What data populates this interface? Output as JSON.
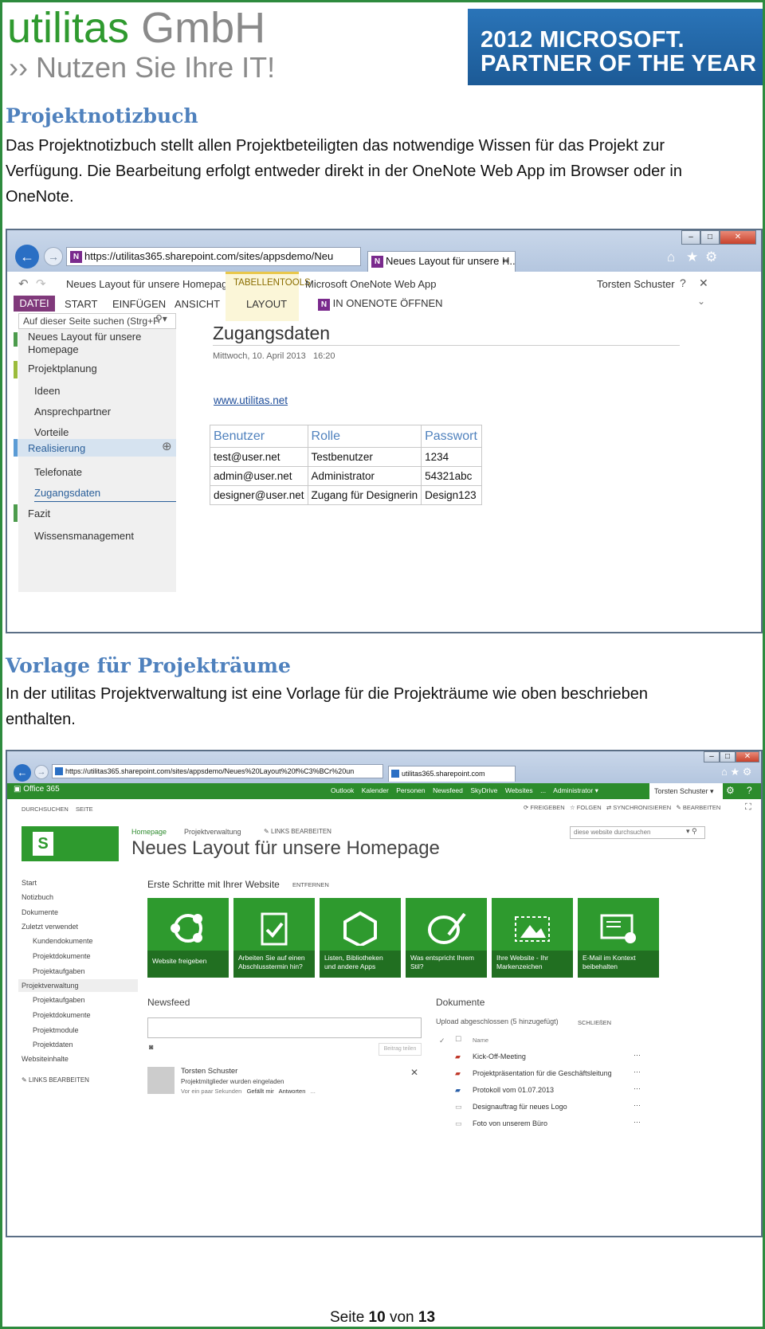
{
  "header": {
    "company_name": "utilitas",
    "company_suffix": "GmbH",
    "slogan": "›› Nutzen Sie Ihre IT!",
    "partner_line1": "2012 MICROSOFT.",
    "partner_line2": "PARTNER OF THE YEAR"
  },
  "sections": [
    {
      "heading": "Projektnotizbuch",
      "text_l1": "Das Projektnotizbuch stellt allen Projektbeteiligten das notwendige Wissen für das Projekt zur",
      "text_l2": "Verfügung. Die Bearbeitung erfolgt entweder direkt in der OneNote Web App im Browser oder in",
      "text_l3": "OneNote."
    },
    {
      "heading": "Vorlage für Projekträume",
      "text_l1": "In der utilitas Projektverwaltung ist eine Vorlage für die Projekträume wie oben beschrieben",
      "text_l2": "enthalten."
    }
  ],
  "onenote": {
    "url": "https://utilitas365.sharepoint.com/sites/appsdemo/Neu",
    "tab_title": "Neues Layout für unsere H...",
    "breadcrumb": "Neues Layout für unsere Homepage_I",
    "tabellentools": "TABELLENTOOLS",
    "app_name": "Microsoft OneNote Web App",
    "user": "Torsten Schuster",
    "ribbon": {
      "datei": "DATEI",
      "start": "START",
      "einfuegen": "EINFÜGEN",
      "ansicht": "ANSICHT",
      "layout": "LAYOUT",
      "open_in": "IN ONENOTE ÖFFNEN"
    },
    "search_placeholder": "Auf dieser Seite suchen (Strg+F",
    "nav": {
      "s1_l1": "Neues Layout für unsere",
      "s1_l2": "Homepage",
      "s2": "Projektplanung",
      "p_ideen": "Ideen",
      "p_ansprech": "Ansprechpartner",
      "p_vorteile": "Vorteile",
      "s3": "Realisierung",
      "p_telefonate": "Telefonate",
      "p_zugang": "Zugangsdaten",
      "s4": "Fazit",
      "p_wissen": "Wissensmanagement"
    },
    "page_title": "Zugangsdaten",
    "page_date": "Mittwoch, 10. April 2013",
    "page_time": "16:20",
    "link": "www.utilitas.net",
    "table": {
      "headers": [
        "Benutzer",
        "Rolle",
        "Passwort"
      ],
      "rows": [
        [
          "test@user.net",
          "Testbenutzer",
          "1234"
        ],
        [
          "admin@user.net",
          "Administrator",
          "54321abc"
        ],
        [
          "designer@user.net",
          "Zugang für Designerin",
          "Design123"
        ]
      ]
    }
  },
  "sharepoint": {
    "url": "https://utilitas365.sharepoint.com/sites/appsdemo/Neues%20Layout%20f%C3%BCr%20un",
    "tab_title": "utilitas365.sharepoint.com",
    "brand": "Office 365",
    "topnav": [
      "Outlook",
      "Kalender",
      "Personen",
      "Newsfeed",
      "SkyDrive",
      "Websites",
      "...",
      "Administrator ▾"
    ],
    "user": "Torsten Schuster ▾",
    "durchsuchen": "DURCHSUCHEN",
    "seite": "SEITE",
    "actions": {
      "freigeben": "FREIGEBEN",
      "folgen": "FOLGEN",
      "sync": "SYNCHRONISIEREN",
      "bearbeiten": "BEARBEITEN"
    },
    "crumb_home": "Homepage",
    "crumb_pv": "Projektverwaltung",
    "links_bearbeiten": "LINKS BEARBEITEN",
    "site_title": "Neues Layout für unsere Homepage",
    "search_placeholder": "diese website durchsuchen",
    "leftnav": [
      "Start",
      "Notizbuch",
      "Dokumente",
      "Zuletzt verwendet",
      "Kundendokumente",
      "Projektdokumente",
      "Projektaufgaben",
      "Projektverwaltung",
      "Projektaufgaben",
      "Projektdokumente",
      "Projektmodule",
      "Projektdaten",
      "Websiteinhalte",
      "LINKS BEARBEITEN"
    ],
    "getting_started": "Erste Schritte mit Ihrer Website",
    "entfernen": "ENTFERNEN",
    "tiles": [
      {
        "l1": "",
        "l2": "Website freigeben"
      },
      {
        "l1": "Arbeiten Sie auf einen",
        "l2": "Abschlusstermin hin?"
      },
      {
        "l1": "Listen, Bibliotheken",
        "l2": "und andere Apps"
      },
      {
        "l1": "Was entspricht Ihrem",
        "l2": "Stil?"
      },
      {
        "l1": "Ihre Website - Ihr",
        "l2": "Markenzeichen"
      },
      {
        "l1": "E-Mail im Kontext",
        "l2": "beibehalten"
      }
    ],
    "newsfeed": "Newsfeed",
    "post_button": "Beitrag teilen",
    "post_author": "Torsten Schuster",
    "post_text": "Projektmitglieder wurden eingeladen",
    "post_time": "Vor ein paar Sekunden",
    "post_like": "Gefällt mir",
    "post_reply": "Antworten",
    "post_more": "...",
    "documents": "Dokumente",
    "upload_status": "Upload abgeschlossen (5 hinzugefügt)",
    "schliessen": "SCHLIEßEN",
    "col_name": "Name",
    "docs": [
      "Kick-Off-Meeting",
      "Projektpräsentation für die Geschäftsleitung",
      "Protokoll vom 01.07.2013",
      "Designauftrag für neues Logo",
      "Foto von unserem Büro"
    ]
  },
  "footer": {
    "prefix": "Seite",
    "page": "10",
    "middle": "von",
    "total": "13"
  }
}
